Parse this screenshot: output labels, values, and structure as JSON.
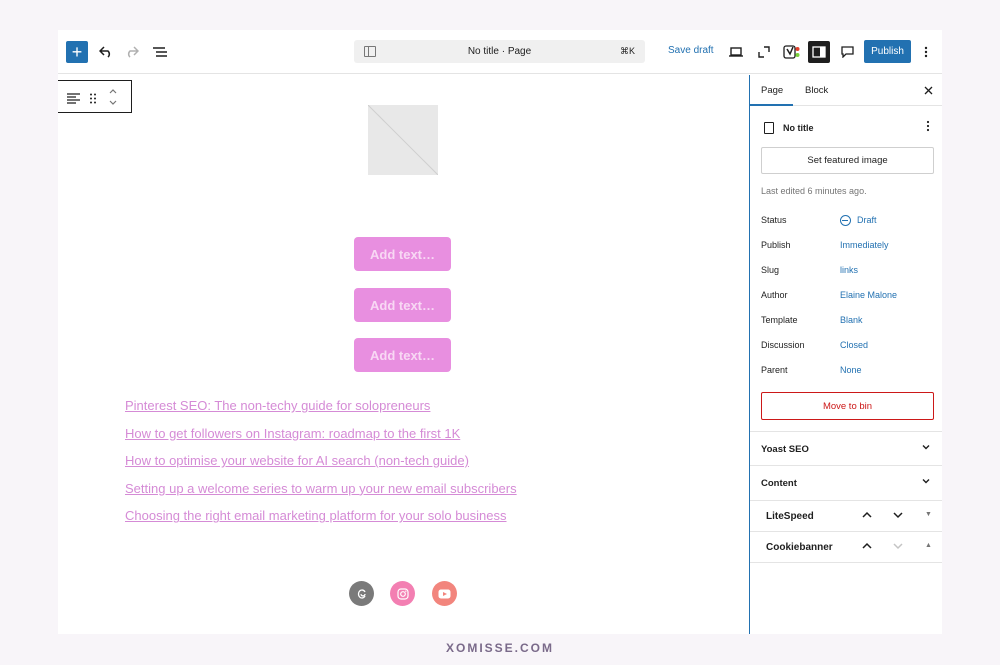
{
  "toolbar": {
    "doc_title": "No title · Page",
    "shortcut": "⌘K",
    "save_draft": "Save draft",
    "publish": "Publish"
  },
  "canvas": {
    "buttons": [
      "Add text…",
      "Add text…",
      "Add text…"
    ],
    "links": [
      "Pinterest SEO: The non-techy guide for solopreneurs",
      "How to get followers on Instagram: roadmap to the first 1K",
      "How to optimise your website for AI search (non-tech guide)",
      "Setting up a welcome series to warm up your new email subscribers",
      "Choosing the right email marketing platform for your solo business"
    ],
    "social_icons": [
      "threads-icon",
      "instagram-icon",
      "youtube-icon"
    ]
  },
  "sidebar": {
    "tabs": {
      "page": "Page",
      "block": "Block"
    },
    "doc_title": "No title",
    "featured_image": "Set featured image",
    "last_edited": "Last edited 6 minutes ago.",
    "meta": [
      {
        "key": "Status",
        "value": "Draft"
      },
      {
        "key": "Publish",
        "value": "Immediately"
      },
      {
        "key": "Slug",
        "value": "links"
      },
      {
        "key": "Author",
        "value": "Elaine Malone"
      },
      {
        "key": "Template",
        "value": "Blank"
      },
      {
        "key": "Discussion",
        "value": "Closed"
      },
      {
        "key": "Parent",
        "value": "None"
      }
    ],
    "move_to_bin": "Move to bin",
    "panels": [
      "Yoast SEO",
      "Content"
    ],
    "metaboxes": [
      "LiteSpeed",
      "Cookiebanner"
    ]
  },
  "footer": {
    "brand": "XOMISSE.COM"
  },
  "colors": {
    "accent": "#2271b1",
    "button_pink": "#e88fe0",
    "link_pink": "#d58bd6",
    "danger": "#cc1818"
  }
}
